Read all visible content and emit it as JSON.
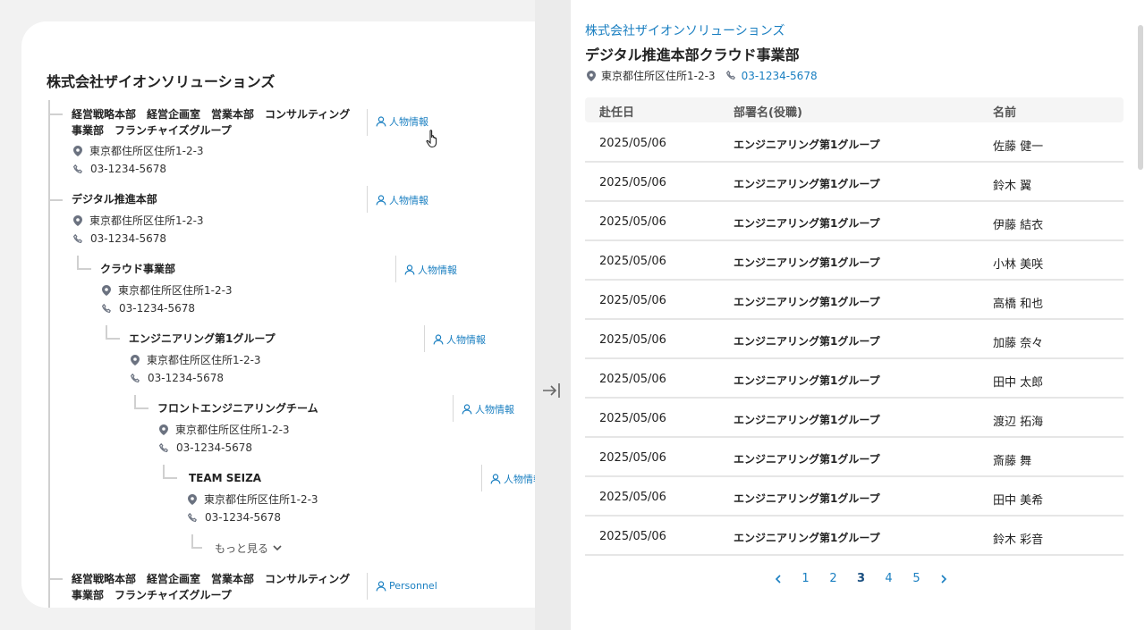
{
  "left": {
    "title": "株式会社ザイオンソリューションズ",
    "nodes": [
      {
        "name_line1": "経営戦略本部　経営企画室　営業本部　コンサルティング",
        "name_line2": "事業部　フランチャイズグループ",
        "address": "東京都住所区住所1-2-3",
        "phone": "03-1234-5678",
        "link": "人物情報"
      },
      {
        "name": "デジタル推進本部",
        "address": "東京都住所区住所1-2-3",
        "phone": "03-1234-5678",
        "link": "人物情報"
      },
      {
        "name": "クラウド事業部",
        "address": "東京都住所区住所1-2-3",
        "phone": "03-1234-5678",
        "link": "人物情報"
      },
      {
        "name": "エンジニアリング第1グループ",
        "address": "東京都住所区住所1-2-3",
        "phone": "03-1234-5678",
        "link": "人物情報"
      },
      {
        "name": "フロントエンジニアリングチーム",
        "address": "東京都住所区住所1-2-3",
        "phone": "03-1234-5678",
        "link": "人物情報"
      },
      {
        "name": "TEAM SEIZA",
        "address": "東京都住所区住所1-2-3",
        "phone": "03-1234-5678",
        "link": "人物情報"
      },
      {
        "name_line1": "経営戦略本部　経営企画室　営業本部　コンサルティング",
        "name_line2": "事業部　フランチャイズグループ",
        "link": "Personnel"
      }
    ],
    "more_label": "もっと見る"
  },
  "panel": {
    "company": "株式会社ザイオンソリューションズ",
    "department": "デジタル推進本部クラウド事業部",
    "address": "東京都住所区住所1-2-3",
    "phone": "03-1234-5678",
    "columns": [
      "赴任日",
      "部署名(役職)",
      "名前"
    ],
    "rows": [
      {
        "date": "2025/05/06",
        "dept": "エンジニアリング第1グループ",
        "name": "佐藤 健一"
      },
      {
        "date": "2025/05/06",
        "dept": "エンジニアリング第1グループ",
        "name": "鈴木 翼"
      },
      {
        "date": "2025/05/06",
        "dept": "エンジニアリング第1グループ",
        "name": "伊藤 結衣"
      },
      {
        "date": "2025/05/06",
        "dept": "エンジニアリング第1グループ",
        "name": "小林 美咲"
      },
      {
        "date": "2025/05/06",
        "dept": "エンジニアリング第1グループ",
        "name": "高橋 和也"
      },
      {
        "date": "2025/05/06",
        "dept": "エンジニアリング第1グループ",
        "name": "加藤 奈々"
      },
      {
        "date": "2025/05/06",
        "dept": "エンジニアリング第1グループ",
        "name": "田中 太郎"
      },
      {
        "date": "2025/05/06",
        "dept": "エンジニアリング第1グループ",
        "name": "渡辺 拓海"
      },
      {
        "date": "2025/05/06",
        "dept": "エンジニアリング第1グループ",
        "name": "斎藤 舞"
      },
      {
        "date": "2025/05/06",
        "dept": "エンジニアリング第1グループ",
        "name": "田中 美希"
      },
      {
        "date": "2025/05/06",
        "dept": "エンジニアリング第1グループ",
        "name": "鈴木 彩音"
      }
    ],
    "pages": [
      "1",
      "2",
      "3",
      "4",
      "5"
    ],
    "current_page": "3"
  },
  "colors": {
    "accent": "#1a7fc1",
    "line": "#d0d0d0",
    "strip": "#ebebeb"
  },
  "icons": [
    "pin-icon",
    "phone-icon",
    "person-icon",
    "chevron-down-icon",
    "chevron-left-icon",
    "chevron-right-icon",
    "collapse-panel-icon",
    "hand-cursor-icon"
  ]
}
